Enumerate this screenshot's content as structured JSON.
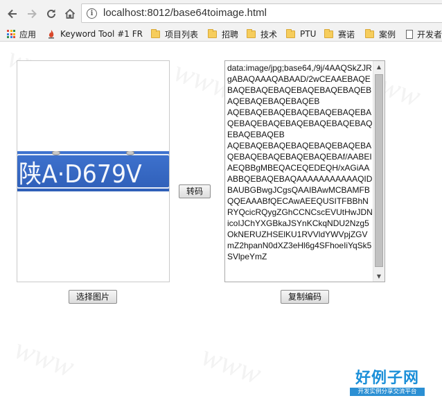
{
  "browser": {
    "url": "localhost:8012/base64toimage.html"
  },
  "bookmarks": [
    {
      "label": "应用",
      "icon": "apps-grid-icon"
    },
    {
      "label": "Keyword Tool #1 FR",
      "icon": "keyword-tool-icon"
    },
    {
      "label": "项目列表",
      "icon": "folder-icon"
    },
    {
      "label": "招聘",
      "icon": "folder-icon"
    },
    {
      "label": "技术",
      "icon": "folder-icon"
    },
    {
      "label": "PTU",
      "icon": "folder-icon"
    },
    {
      "label": "赛诺",
      "icon": "folder-icon"
    },
    {
      "label": "案例",
      "icon": "folder-icon"
    },
    {
      "label": "开发者",
      "icon": "page-icon"
    }
  ],
  "image_preview": {
    "plate_text": "陕A·D679V",
    "plate_color": "#3f73cf"
  },
  "buttons": {
    "convert": "转码",
    "select_image": "选择图片",
    "copy_code": "复制编码"
  },
  "base64_text": "data:image/jpg;base64,/9j/4AAQSkZJRgABAQAAAQABAAD/2wCEAAEBAQEBAQEBAQEBAQEBAQEBAQEBAQEBAQEBAQEBAQEBAQEB\nAQEBAQEBAQEBAQEBAQEBAQEBAQEBAQEBAQEBAQEBAQEBAQEBAQEBAQEBAQEB\nAQEBAQEBAQEBAQEBAQEBAQEBAQEBAQEBAQEBAQEBAQEBAf/AABEIAEQBBgMBEQACEQEDEQH/xAGiAAABBQEBAQEBAQAAAAAAAAAAAQIDBAUBGBwgJCgsQAAIBAwMCBAMFBQQEAAABfQECAwAEEQUSITFBBhNRYQcicRQygZGhCCNCscEVUtHwJDNicoIJChYXGBkaJSYnKCkqNDU2Nzg5OkNERUZHSElKU1RVVldYWVpjZGVmZ2hpanN0dXZ3eHl6g4SFhoeIiYqSk5SVlpeYmZ"
}
